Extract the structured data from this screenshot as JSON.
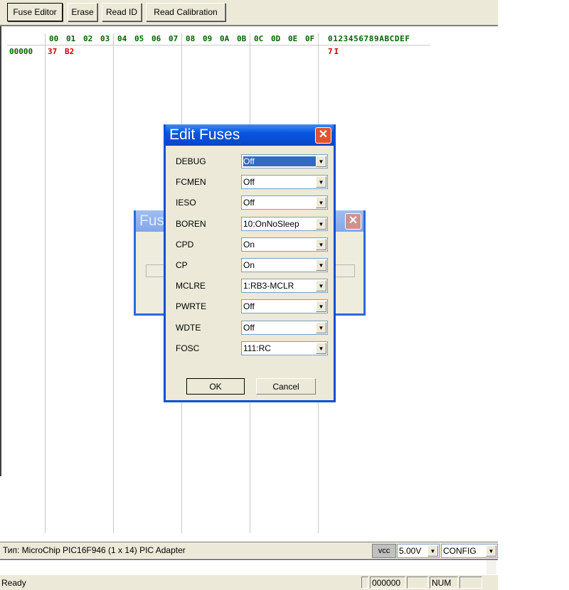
{
  "toolbar": {
    "fuse_editor": "Fuse Editor",
    "erase": "Erase",
    "read_id": "Read ID",
    "read_calibration": "Read Calibration"
  },
  "hex": {
    "address_header": [
      "00",
      "01",
      "02",
      "03",
      "04",
      "05",
      "06",
      "07",
      "08",
      "09",
      "0A",
      "0B",
      "0C",
      "0D",
      "0E",
      "0F"
    ],
    "ascii_header": "0123456789ABCDEF",
    "rows": [
      {
        "address": "00000",
        "bytes": [
          "37",
          "B2"
        ],
        "ascii": "7I"
      }
    ]
  },
  "background_dialog": {
    "title": "Fuse"
  },
  "dialog": {
    "title": "Edit Fuses",
    "fuses": [
      {
        "name": "DEBUG",
        "value": "Off"
      },
      {
        "name": "FCMEN",
        "value": "Off"
      },
      {
        "name": "IESO",
        "value": "Off"
      },
      {
        "name": "BOREN",
        "value": "10:OnNoSleep"
      },
      {
        "name": "CPD",
        "value": "On"
      },
      {
        "name": "CP",
        "value": "On"
      },
      {
        "name": "MCLRE",
        "value": "1:RB3-MCLR"
      },
      {
        "name": "PWRTE",
        "value": "Off"
      },
      {
        "name": "WDTE",
        "value": "Off"
      },
      {
        "name": "FOSC",
        "value": "111:RC"
      }
    ],
    "ok": "OK",
    "cancel": "Cancel"
  },
  "statusbar": {
    "device": "Тип: MicroChip PIC16F946 (1 x 14)   PIC Adapter",
    "vcc": "vcc",
    "voltage": "5.00V",
    "mode": "CONFIG",
    "ready": "Ready",
    "address": "000000",
    "num": "NUM"
  },
  "colors": {
    "hex_green": "#006400",
    "data_red": "#d00000",
    "titlebar": "#0a55e0"
  }
}
